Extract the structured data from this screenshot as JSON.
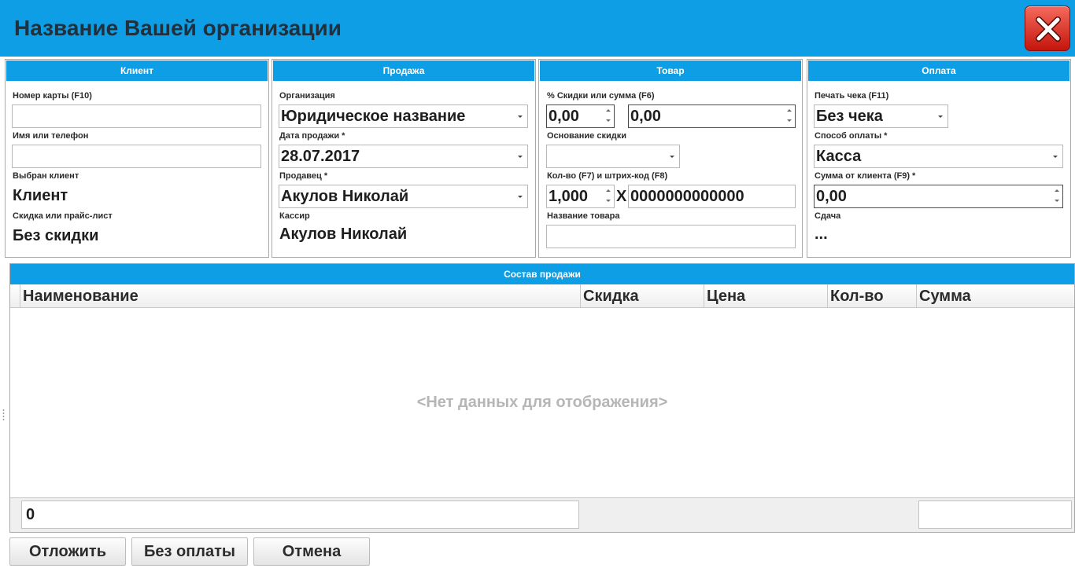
{
  "app": {
    "title": "Название Вашей организации"
  },
  "client": {
    "header": "Клиент",
    "card_label": "Номер карты (F10)",
    "card_value": "",
    "name_label": "Имя или телефон",
    "name_value": "",
    "selected_label": "Выбран клиент",
    "selected_value": "Клиент",
    "discount_label": "Скидка или прайс-лист",
    "discount_value": "Без скидки"
  },
  "sale": {
    "header": "Продажа",
    "org_label": "Организация",
    "org_value": "Юридическое название",
    "date_label": "Дата продажи *",
    "date_value": "28.07.2017",
    "seller_label": "Продавец *",
    "seller_value": "Акулов Николай",
    "cashier_label": "Кассир",
    "cashier_value": "Акулов Николай"
  },
  "product": {
    "header": "Товар",
    "discount_label": "% Скидки или сумма (F6)",
    "discount_percent": "0,00",
    "discount_sum": "0,00",
    "reason_label": "Основание скидки",
    "reason_value": "",
    "qty_label": "Кол-во (F7) и штрих-код (F8)",
    "qty_value": "1,000",
    "times": "X",
    "barcode_value": "0000000000000",
    "name_label": "Название товара",
    "name_value": ""
  },
  "payment": {
    "header": "Оплата",
    "receipt_label": "Печать чека (F11)",
    "receipt_value": "Без чека",
    "method_label": "Способ оплаты *",
    "method_value": "Касса",
    "amount_label": "Сумма от клиента (F9) *",
    "amount_value": "0,00",
    "change_label": "Сдача",
    "change_value": "..."
  },
  "grid": {
    "header": "Состав продажи",
    "columns": [
      "Наименование",
      "Скидка",
      "Цена",
      "Кол-во",
      "Сумма"
    ],
    "empty_text": "<Нет данных для отображения>",
    "footer_count": "0",
    "footer_total": ""
  },
  "actions": {
    "postpone": "Отложить",
    "no_payment": "Без оплаты",
    "cancel": "Отмена"
  },
  "icons": {
    "close": "close-x-icon",
    "dropdown": "chevron-down-icon",
    "spinner": "spinner-arrows-icon"
  },
  "colors": {
    "accent": "#0e9ee6",
    "close": "#d9271a",
    "empty_text": "#b6b6b6"
  }
}
